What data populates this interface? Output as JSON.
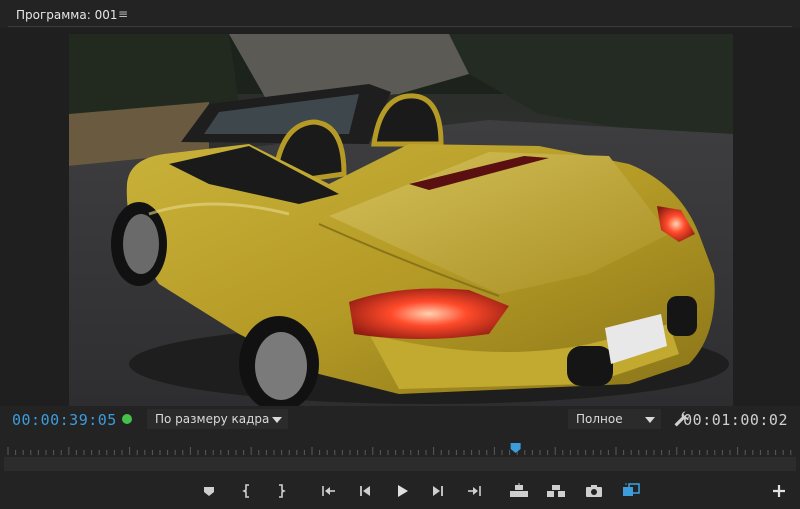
{
  "panel": {
    "title": "Программа: 001",
    "menu_icon": "hamburger-menu-icon"
  },
  "video": {
    "subject": "yellow-convertible-car-frame"
  },
  "controls": {
    "current_timecode": "00:00:39:05",
    "duration_timecode": "00:01:00:02",
    "zoom_select": "По размеру кадра",
    "resolution_select": "Полное",
    "status_color": "#45c04a",
    "timecode_color": "#3c9cdc"
  },
  "playhead": {
    "position_fraction": 0.646
  },
  "transport": {
    "buttons": [
      "add-marker-icon",
      "mark-in-icon",
      "mark-out-icon",
      "go-to-in-icon",
      "step-back-icon",
      "play-icon",
      "step-forward-icon",
      "go-to-out-icon",
      "lift-icon",
      "extract-icon",
      "export-frame-icon",
      "comparison-view-icon",
      "add-button-icon"
    ]
  }
}
